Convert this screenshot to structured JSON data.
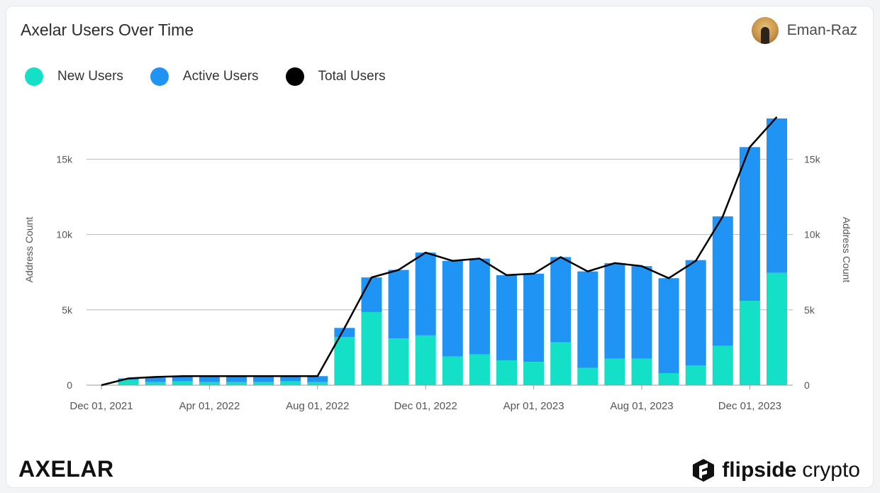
{
  "header": {
    "title": "Axelar Users Over Time",
    "author": "Eman-Raz"
  },
  "footer": {
    "left_brand": "AXELAR",
    "right_brand_bold": "flipside",
    "right_brand_light": "crypto"
  },
  "colors": {
    "new_users": "#14e0c8",
    "active_users": "#1f94f5",
    "total_users": "#000000",
    "grid": "#b9b9b9"
  },
  "chart_data": {
    "type": "bar",
    "stacked": true,
    "legend": [
      {
        "name": "New Users",
        "color": "#14e0c8"
      },
      {
        "name": "Active Users",
        "color": "#1f94f5"
      },
      {
        "name": "Total Users",
        "color": "#000000"
      }
    ],
    "ylabel_left": "Address Count",
    "ylabel_right": "Address Count",
    "ylim": [
      0,
      18500
    ],
    "yticks": [
      0,
      5000,
      10000,
      15000
    ],
    "ytick_labels": [
      "0",
      "5k",
      "10k",
      "15k"
    ],
    "xtick_labels": [
      "Dec 01, 2021",
      "Apr 01, 2022",
      "Aug 01, 2022",
      "Dec 01, 2022",
      "Apr 01, 2023",
      "Aug 01, 2023",
      "Dec 01, 2023"
    ],
    "categories": [
      "2021-12",
      "2022-01",
      "2022-02",
      "2022-03",
      "2022-04",
      "2022-05",
      "2022-06",
      "2022-07",
      "2022-08",
      "2022-09",
      "2022-10",
      "2022-11",
      "2022-12",
      "2023-01",
      "2023-02",
      "2023-03",
      "2023-04",
      "2023-05",
      "2023-06",
      "2023-07",
      "2023-08",
      "2023-09",
      "2023-10",
      "2023-11",
      "2023-12",
      "2024-01"
    ],
    "series": [
      {
        "name": "New Users",
        "type": "bar",
        "values": [
          0,
          350,
          200,
          250,
          200,
          200,
          200,
          250,
          200,
          3200,
          4850,
          3100,
          3300,
          1900,
          2050,
          1650,
          1550,
          2850,
          1150,
          1750,
          1750,
          800,
          1300,
          2600,
          5600,
          7450
        ]
      },
      {
        "name": "Active Users",
        "type": "bar",
        "values": [
          0,
          100,
          300,
          350,
          400,
          400,
          400,
          350,
          400,
          600,
          2300,
          4550,
          5500,
          6350,
          6350,
          5650,
          5850,
          5650,
          6400,
          6350,
          6150,
          6300,
          7000,
          8600,
          10200,
          10250
        ]
      },
      {
        "name": "Total Users",
        "type": "line",
        "values": [
          0,
          450,
          550,
          600,
          600,
          600,
          600,
          600,
          600,
          3800,
          7150,
          7650,
          8800,
          8250,
          8400,
          7300,
          7400,
          8500,
          7550,
          8100,
          7900,
          7100,
          8250,
          11200,
          15800,
          17800
        ]
      }
    ]
  }
}
